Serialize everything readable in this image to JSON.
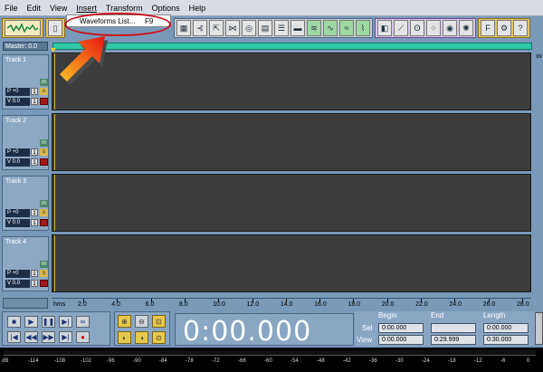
{
  "menubar": [
    "File",
    "Edit",
    "View",
    "Insert",
    "Transform",
    "Options",
    "Help"
  ],
  "dropdown": {
    "item": "Waveforms List...",
    "shortcut": "F9"
  },
  "master": {
    "label": "Master: 0.0"
  },
  "tracks": [
    {
      "name": "Track 1",
      "pan": "P +0",
      "vol": "V 0.0",
      "num": "1"
    },
    {
      "name": "Track 2",
      "pan": "P +0",
      "vol": "V 0.0",
      "num": "2"
    },
    {
      "name": "Track 3",
      "pan": "P +0",
      "vol": "V 0.0",
      "num": "3"
    },
    {
      "name": "Track 4",
      "pan": "P +0",
      "vol": "V 0.0",
      "num": "4"
    }
  ],
  "track_buttons": {
    "mute": "m",
    "solo": "s",
    "one": "1"
  },
  "right_ruler_top": "trk",
  "time_ruler": {
    "unit": "hms",
    "ticks": [
      "2.0",
      "4.0",
      "6.0",
      "8.0",
      "10.0",
      "12.0",
      "14.0",
      "16.0",
      "18.0",
      "20.0",
      "22.0",
      "24.0",
      "26.0",
      "28.0"
    ]
  },
  "time_display": "0:00.000",
  "selview": {
    "head_begin": "Begin",
    "head_end": "End",
    "head_length": "Length",
    "sel_label": "Sel",
    "view_label": "View",
    "sel_begin": "0:00.000",
    "sel_end": "",
    "sel_length": "0:00.000",
    "view_begin": "0:00.000",
    "view_end": "0:29.999",
    "view_length": "0:30.000"
  },
  "meter_ticks": [
    "dB",
    "-114",
    "-108",
    "-102",
    "-96",
    "-90",
    "-84",
    "-78",
    "-72",
    "-66",
    "-60",
    "-54",
    "-48",
    "-42",
    "-36",
    "-30",
    "-24",
    "-18",
    "-12",
    "-6",
    "0"
  ]
}
